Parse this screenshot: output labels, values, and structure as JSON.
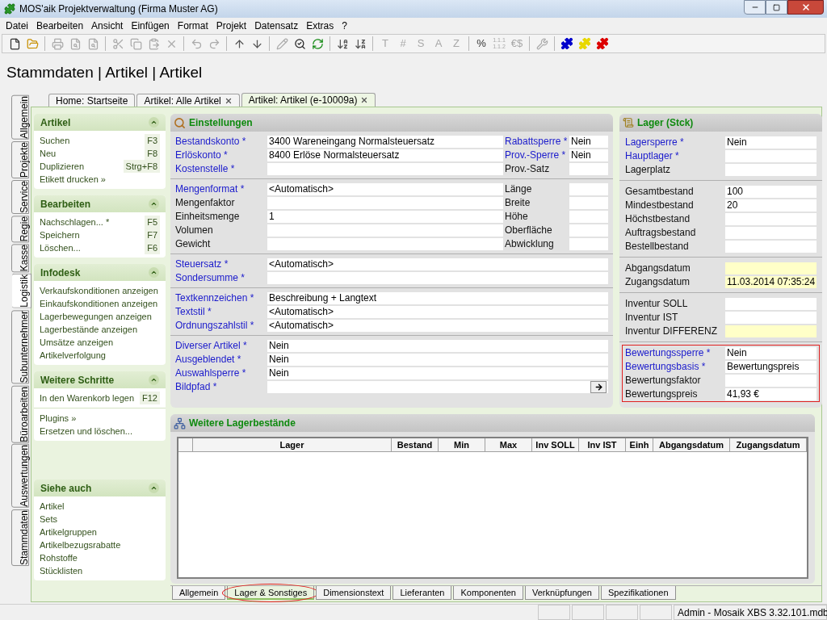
{
  "window": {
    "title": "MOS'aik Projektverwaltung (Firma Muster AG)"
  },
  "menu": [
    "Datei",
    "Bearbeiten",
    "Ansicht",
    "Einfügen",
    "Format",
    "Projekt",
    "Datensatz",
    "Extras",
    "?"
  ],
  "toolbar": [
    {
      "kind": "new",
      "disabled": false
    },
    {
      "kind": "open",
      "disabled": false
    },
    {
      "kind": "sep"
    },
    {
      "kind": "print",
      "disabled": true
    },
    {
      "kind": "preview",
      "disabled": true
    },
    {
      "kind": "preview",
      "disabled": true
    },
    {
      "kind": "sep"
    },
    {
      "kind": "cut",
      "disabled": true
    },
    {
      "kind": "copy",
      "disabled": true
    },
    {
      "kind": "paste",
      "disabled": true
    },
    {
      "kind": "delete",
      "disabled": true
    },
    {
      "kind": "sep"
    },
    {
      "kind": "undo",
      "disabled": true
    },
    {
      "kind": "redo",
      "disabled": true
    },
    {
      "kind": "sep"
    },
    {
      "kind": "up",
      "disabled": false
    },
    {
      "kind": "down",
      "disabled": false
    },
    {
      "kind": "sep"
    },
    {
      "kind": "pencil",
      "disabled": true
    },
    {
      "kind": "find",
      "disabled": false
    },
    {
      "kind": "refresh",
      "disabled": false
    },
    {
      "kind": "sep"
    },
    {
      "kind": "sort_az",
      "disabled": false
    },
    {
      "kind": "sort_za",
      "disabled": false
    },
    {
      "kind": "sep"
    },
    {
      "kind": "glyph",
      "text": "T",
      "disabled": true
    },
    {
      "kind": "glyph",
      "text": "#",
      "disabled": true
    },
    {
      "kind": "glyph",
      "text": "S",
      "disabled": true
    },
    {
      "kind": "glyph",
      "text": "A",
      "disabled": true
    },
    {
      "kind": "glyph",
      "text": "Z",
      "disabled": true
    },
    {
      "kind": "sep"
    },
    {
      "kind": "glyph",
      "text": "%",
      "disabled": false
    },
    {
      "kind": "numbering",
      "lines": [
        "1.1.1",
        "1.1.2"
      ],
      "disabled": true
    },
    {
      "kind": "glyph",
      "text": "€$",
      "disabled": true
    },
    {
      "kind": "sep"
    },
    {
      "kind": "tools",
      "disabled": true
    },
    {
      "kind": "sep"
    },
    {
      "kind": "puzzle",
      "color": "#0000cc",
      "disabled": false
    },
    {
      "kind": "puzzle",
      "color": "#e8d800",
      "disabled": false
    },
    {
      "kind": "puzzle",
      "color": "#dd0000",
      "disabled": false
    }
  ],
  "breadcrumb": "Stammdaten | Artikel | Artikel",
  "doc_tabs": [
    {
      "label": "Home: Startseite",
      "closable": false,
      "selected": false
    },
    {
      "label": "Artikel: Alle Artikel",
      "closable": true,
      "selected": false
    },
    {
      "label": "Artikel: Artikel (e-10009a)",
      "closable": true,
      "selected": true
    }
  ],
  "side_tabs": [
    {
      "label": "Allgemein",
      "selected": false
    },
    {
      "label": "Projekte",
      "selected": false
    },
    {
      "label": "Service",
      "selected": false
    },
    {
      "label": "Regie",
      "selected": false
    },
    {
      "label": "Kasse",
      "selected": false
    },
    {
      "label": "Logistik",
      "selected": true
    },
    {
      "label": "Subunternehmer",
      "selected": false
    },
    {
      "label": "Büroarbeiten",
      "selected": false
    },
    {
      "label": "Auswertungen",
      "selected": false
    },
    {
      "label": "Stammdaten",
      "selected": false
    }
  ],
  "task_panels": [
    {
      "title": "Artikel",
      "groups": [
        [
          {
            "label": "Suchen",
            "shortcut": "F3"
          },
          {
            "label": "Neu",
            "shortcut": "F8"
          },
          {
            "label": "Duplizieren",
            "shortcut": "Strg+F8"
          },
          {
            "label": "Etikett drucken »"
          }
        ]
      ]
    },
    {
      "title": "Bearbeiten",
      "groups": [
        [
          {
            "label": "Nachschlagen... *",
            "shortcut": "F5"
          },
          {
            "label": "Speichern",
            "shortcut": "F7"
          },
          {
            "label": "Löschen...",
            "shortcut": "F6"
          }
        ]
      ]
    },
    {
      "title": "Infodesk",
      "groups": [
        [
          {
            "label": "Verkaufskonditionen anzeigen"
          },
          {
            "label": "Einkaufskonditionen anzeigen"
          },
          {
            "label": "Lagerbewegungen anzeigen"
          },
          {
            "label": "Lagerbestände anzeigen"
          },
          {
            "label": "Umsätze anzeigen"
          },
          {
            "label": "Artikelverfolgung"
          }
        ]
      ]
    },
    {
      "title": "Weitere Schritte",
      "groups": [
        [
          {
            "label": "In den Warenkorb legen",
            "shortcut": "F12"
          }
        ],
        [
          {
            "label": "Plugins »"
          },
          {
            "label": "Ersetzen und löschen..."
          }
        ]
      ]
    },
    {
      "title": "Siehe auch",
      "groups": [
        [
          {
            "label": "Artikel"
          },
          {
            "label": "Sets"
          },
          {
            "label": "Artikelgruppen"
          },
          {
            "label": "Artikelbezugsrabatte"
          },
          {
            "label": "Rohstoffe"
          },
          {
            "label": "Stücklisten"
          }
        ]
      ]
    }
  ],
  "settings": {
    "title": "Einstellungen",
    "groups": [
      [
        {
          "label": "Bestandskonto *",
          "link": true,
          "value": "3400 Wareneingang Normalsteuersatz",
          "side": {
            "label": "Rabattsperre *",
            "link": true,
            "value": "Nein"
          }
        },
        {
          "label": "Erlöskonto *",
          "link": true,
          "value": "8400 Erlöse Normalsteuersatz",
          "side": {
            "label": "Prov.-Sperre *",
            "link": true,
            "value": "Nein"
          }
        },
        {
          "label": "Kostenstelle *",
          "link": true,
          "side": {
            "label": "Prov.-Satz",
            "link": false
          }
        }
      ],
      [
        {
          "label": "Mengenformat *",
          "link": true,
          "value": "<Automatisch>",
          "side": {
            "label": "Länge",
            "link": false
          }
        },
        {
          "label": "Mengenfaktor",
          "link": false,
          "side": {
            "label": "Breite",
            "link": false
          }
        },
        {
          "label": "Einheitsmenge",
          "link": false,
          "value": "1",
          "side": {
            "label": "Höhe",
            "link": false
          }
        },
        {
          "label": "Volumen",
          "link": false,
          "side": {
            "label": "Oberfläche",
            "link": false
          }
        },
        {
          "label": "Gewicht",
          "link": false,
          "side": {
            "label": "Abwicklung",
            "link": false
          }
        }
      ],
      [
        {
          "label": "Steuersatz *",
          "link": true,
          "value": "<Automatisch>"
        },
        {
          "label": "Sondersumme *",
          "link": true
        }
      ],
      [
        {
          "label": "Textkennzeichen *",
          "link": true,
          "value": "Beschreibung + Langtext"
        },
        {
          "label": "Textstil *",
          "link": true,
          "value": "<Automatisch>"
        },
        {
          "label": "Ordnungszahlstil *",
          "link": true,
          "value": "<Automatisch>"
        }
      ],
      [
        {
          "label": "Diverser Artikel *",
          "link": true,
          "value": "Nein"
        },
        {
          "label": "Ausgeblendet *",
          "link": true,
          "value": "Nein"
        },
        {
          "label": "Auswahlsperre *",
          "link": true,
          "value": "Nein"
        },
        {
          "label": "Bildpfad *",
          "link": true,
          "button": true
        }
      ]
    ]
  },
  "stock": {
    "title": "Lager (Stck)",
    "groups": [
      {
        "marked": false,
        "rows": [
          {
            "label": "Lagersperre *",
            "link": true,
            "value": "Nein",
            "highlight": false
          },
          {
            "label": "Hauptlager *",
            "link": true,
            "highlight": false
          },
          {
            "label": "Lagerplatz",
            "link": false,
            "highlight": false
          }
        ]
      },
      {
        "marked": false,
        "rows": [
          {
            "label": "Gesamtbestand",
            "link": false,
            "value": "100",
            "highlight": false
          },
          {
            "label": "Mindestbestand",
            "link": false,
            "value": "20",
            "highlight": false
          },
          {
            "label": "Höchstbestand",
            "link": false,
            "highlight": false
          },
          {
            "label": "Auftragsbestand",
            "link": false,
            "highlight": false
          },
          {
            "label": "Bestellbestand",
            "link": false,
            "highlight": false
          }
        ]
      },
      {
        "marked": false,
        "rows": [
          {
            "label": "Abgangsdatum",
            "link": false,
            "highlight": true
          },
          {
            "label": "Zugangsdatum",
            "link": false,
            "value": "11.03.2014 07:35:24",
            "highlight": true
          }
        ]
      },
      {
        "marked": false,
        "rows": [
          {
            "label": "Inventur SOLL",
            "link": false,
            "highlight": false
          },
          {
            "label": "Inventur IST",
            "link": false,
            "highlight": false
          },
          {
            "label": "Inventur DIFFERENZ",
            "link": false,
            "highlight": true
          }
        ]
      },
      {
        "marked": true,
        "rows": [
          {
            "label": "Bewertungssperre *",
            "link": true,
            "value": "Nein",
            "highlight": false
          },
          {
            "label": "Bewertungsbasis *",
            "link": true,
            "value": "Bewertungspreis",
            "highlight": false
          },
          {
            "label": "Bewertungsfaktor",
            "link": false,
            "highlight": false
          },
          {
            "label": "Bewertungspreis",
            "link": false,
            "value": "41,93 €",
            "highlight": false
          }
        ]
      }
    ]
  },
  "other_stock": {
    "title": "Weitere Lagerbestände",
    "table": {
      "columns": [
        "Lager",
        "Bestand",
        "Min",
        "Max",
        "Inv SOLL",
        "Inv IST",
        "Einh",
        "Abgangsdatum",
        "Zugangsdatum"
      ]
    }
  },
  "bottom_tabs": [
    {
      "label": "Allgemein",
      "selected": false,
      "circled": false
    },
    {
      "label": "Lager & Sonstiges",
      "selected": true,
      "circled": true
    },
    {
      "label": "Dimensionstext",
      "selected": false,
      "circled": false
    },
    {
      "label": "Lieferanten",
      "selected": false,
      "circled": false
    },
    {
      "label": "Komponenten",
      "selected": false,
      "circled": false
    },
    {
      "label": "Verknüpfungen",
      "selected": false,
      "circled": false
    },
    {
      "label": "Spezifikationen",
      "selected": false,
      "circled": false
    }
  ],
  "status_bar": {
    "text": "Admin - Mosaik XBS 3.32.101.mdb"
  }
}
